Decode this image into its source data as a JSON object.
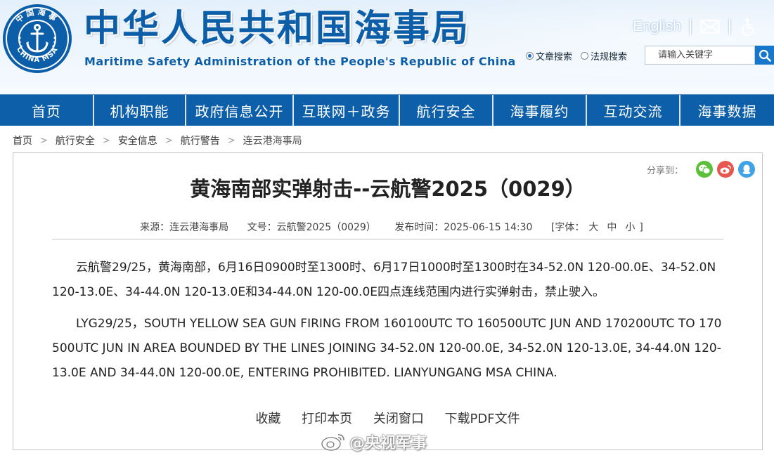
{
  "header": {
    "logo": {
      "text_top": "中国海事",
      "text_bottom": "CHINA MSA",
      "icon": "anchor-emblem"
    },
    "title_cn": "中华人民共和国海事局",
    "title_en": "Maritime Safety Administration of the People's Republic of China",
    "lang_link": "English",
    "mail_icon": "mail-icon",
    "accessibility_icon": "accessibility-icon",
    "search": {
      "option_articles": "文章搜索",
      "option_regulations": "法规搜索",
      "placeholder": "请输入关键字",
      "button_icon": "search-icon"
    }
  },
  "nav": {
    "items": [
      {
        "label": "首页"
      },
      {
        "label": "机构职能"
      },
      {
        "label": "政府信息公开"
      },
      {
        "label": "互联网＋政务"
      },
      {
        "label": "航行安全"
      },
      {
        "label": "海事履约"
      },
      {
        "label": "互动交流"
      },
      {
        "label": "海事数据"
      }
    ]
  },
  "breadcrumb": {
    "separator": ">",
    "items": [
      "首页",
      "航行安全",
      "安全信息",
      "航行警告",
      "连云港海事局"
    ]
  },
  "share": {
    "label": "分享到：",
    "buttons": [
      "wechat-icon",
      "weibo-icon",
      "qq-icon"
    ]
  },
  "article": {
    "title": "黄海南部实弹射击--云航警2025（0029）",
    "meta": {
      "source": "来源：连云港海事局",
      "doc_no": "文号：云航警2025（0029）",
      "published": "发布时间：2025-06-15 14:30",
      "font_label": "[字体：",
      "font_large": "大",
      "font_medium": "中",
      "font_small": "小",
      "font_close": "]"
    },
    "paragraph_cn": "云航警29/25，黄海南部，6月16日0900时至1300时、6月17日1000时至1300时在34-52.0N 120-00.0E、34-52.0N 120-13.0E、34-44.0N 120-13.0E和34-44.0N 120-00.0E四点连线范围内进行实弹射击，禁止驶入。",
    "paragraph_en": "LYG29/25，SOUTH YELLOW SEA GUN FIRING FROM 160100UTC TO 160500UTC JUN AND 170200UTC TO 170500UTC JUN IN AREA BOUNDED BY THE LINES JOINING 34-52.0N 120-00.0E, 34-52.0N 120-13.0E, 34-44.0N 120-13.0E AND 34-44.0N 120-00.0E, ENTERING PROHIBITED. LIANYUNGANG MSA CHINA."
  },
  "actions": {
    "favorite": "收藏",
    "print": "打印本页",
    "close": "关闭窗口",
    "download_pdf": "下载PDF文件"
  },
  "watermark": {
    "text": "@央视军事",
    "icon": "weibo-logo-icon"
  },
  "colors": {
    "nav_bg": "#0c5fa8",
    "brand_blue": "#0d5ea8",
    "search_btn": "#1677cc",
    "wechat": "#5bbf3a",
    "weibo": "#e5574f",
    "qq": "#3fa3e6"
  }
}
